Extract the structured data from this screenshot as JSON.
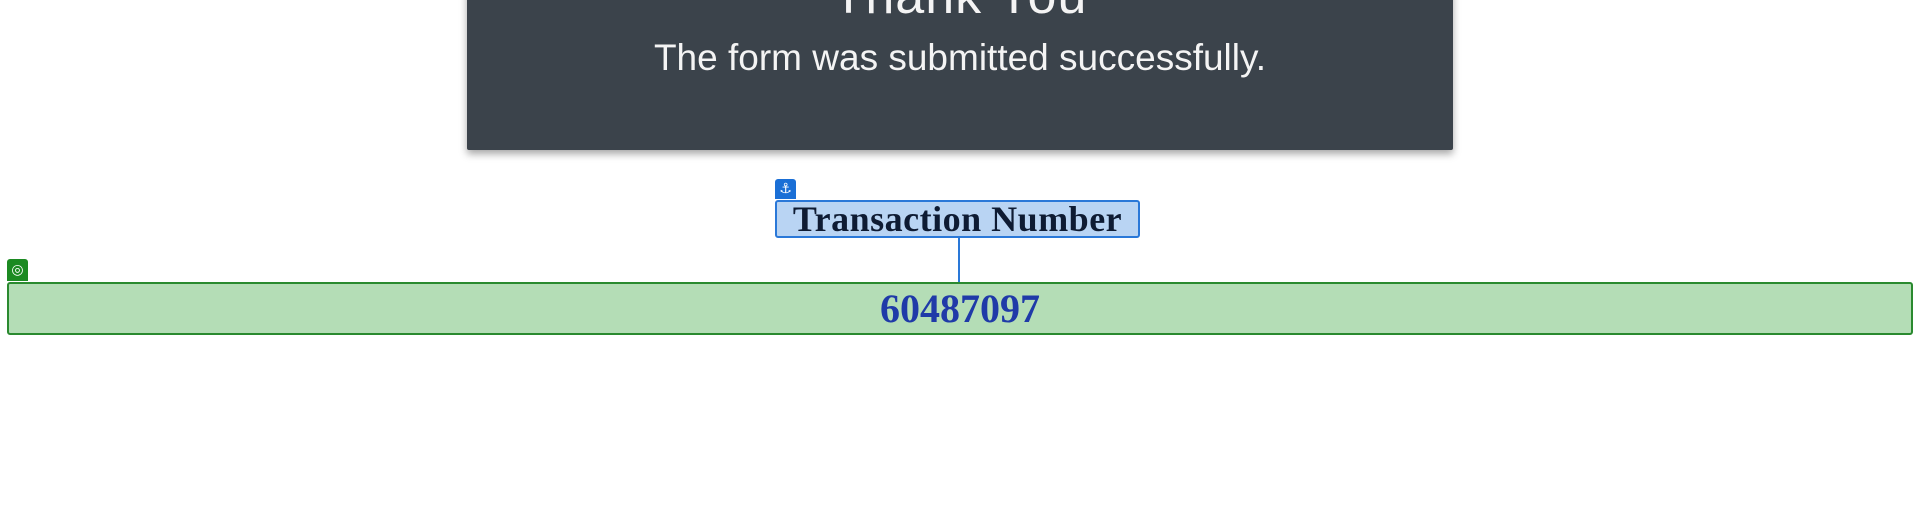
{
  "confirmation": {
    "title": "Thank You",
    "message": "The form was submitted successfully."
  },
  "annotations": {
    "anchor_icon": "anchor-icon",
    "label_text": "Transaction Number",
    "target_icon": "target-icon",
    "value_text": "60487097",
    "label_color": "#2a78d8",
    "value_color": "#2a8a2f"
  }
}
